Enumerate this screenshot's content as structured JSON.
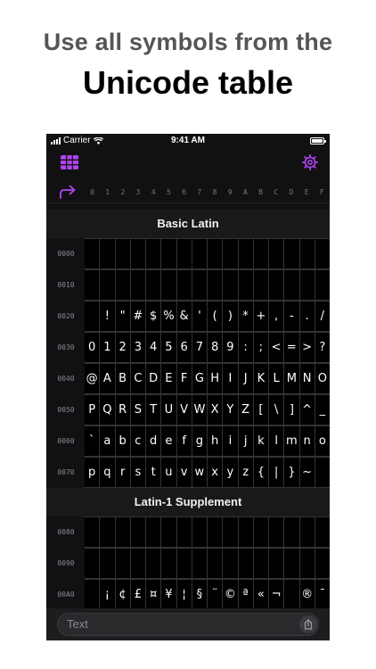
{
  "headline": {
    "line1": "Use all symbols from the",
    "line2": "Unicode table"
  },
  "statusbar": {
    "carrier": "Carrier",
    "time": "9:41 AM"
  },
  "colors": {
    "accent": "#b144f2",
    "background": "#111113",
    "cell": "#000000"
  },
  "toolbar": {
    "grid_icon": "grid-icon",
    "settings_icon": "gear-icon",
    "jump_icon": "forward-arrow-icon"
  },
  "columns": [
    "0",
    "1",
    "2",
    "3",
    "4",
    "5",
    "6",
    "7",
    "8",
    "9",
    "A",
    "B",
    "C",
    "D",
    "E",
    "F"
  ],
  "blocks": [
    {
      "title": "Basic Latin",
      "rows": [
        {
          "label": "0000",
          "cells": [
            "",
            "",
            "",
            "",
            "",
            "",
            "",
            "",
            "",
            "",
            "",
            "",
            "",
            "",
            "",
            ""
          ]
        },
        {
          "label": "0010",
          "cells": [
            "",
            "",
            "",
            "",
            "",
            "",
            "",
            "",
            "",
            "",
            "",
            "",
            "",
            "",
            "",
            ""
          ]
        },
        {
          "label": "0020",
          "cells": [
            "",
            "!",
            "\"",
            "#",
            "$",
            "%",
            "&",
            "'",
            "(",
            ")",
            "*",
            "+",
            ",",
            "-",
            ".",
            "/"
          ]
        },
        {
          "label": "0030",
          "cells": [
            "0",
            "1",
            "2",
            "3",
            "4",
            "5",
            "6",
            "7",
            "8",
            "9",
            ":",
            ";",
            "<",
            "=",
            ">",
            "?"
          ]
        },
        {
          "label": "0040",
          "cells": [
            "@",
            "A",
            "B",
            "C",
            "D",
            "E",
            "F",
            "G",
            "H",
            "I",
            "J",
            "K",
            "L",
            "M",
            "N",
            "O"
          ]
        },
        {
          "label": "0050",
          "cells": [
            "P",
            "Q",
            "R",
            "S",
            "T",
            "U",
            "V",
            "W",
            "X",
            "Y",
            "Z",
            "[",
            "\\",
            "]",
            "^",
            "_"
          ]
        },
        {
          "label": "0060",
          "cells": [
            "`",
            "a",
            "b",
            "c",
            "d",
            "e",
            "f",
            "g",
            "h",
            "i",
            "j",
            "k",
            "l",
            "m",
            "n",
            "o"
          ]
        },
        {
          "label": "0070",
          "cells": [
            "p",
            "q",
            "r",
            "s",
            "t",
            "u",
            "v",
            "w",
            "x",
            "y",
            "z",
            "{",
            "|",
            "}",
            "~",
            ""
          ]
        }
      ]
    },
    {
      "title": "Latin-1 Supplement",
      "rows": [
        {
          "label": "0080",
          "cells": [
            "",
            "",
            "",
            "",
            "",
            "",
            "",
            "",
            "",
            "",
            "",
            "",
            "",
            "",
            "",
            ""
          ]
        },
        {
          "label": "0090",
          "cells": [
            "",
            "",
            "",
            "",
            "",
            "",
            "",
            "",
            "",
            "",
            "",
            "",
            "",
            "",
            "",
            ""
          ]
        },
        {
          "label": "00A0",
          "cells": [
            "",
            "¡",
            "¢",
            "£",
            "¤",
            "¥",
            "¦",
            "§",
            "¨",
            "©",
            "ª",
            "«",
            "¬",
            "",
            "®",
            "¯"
          ]
        }
      ]
    }
  ],
  "input": {
    "placeholder": "Text",
    "share_icon": "share-icon"
  }
}
